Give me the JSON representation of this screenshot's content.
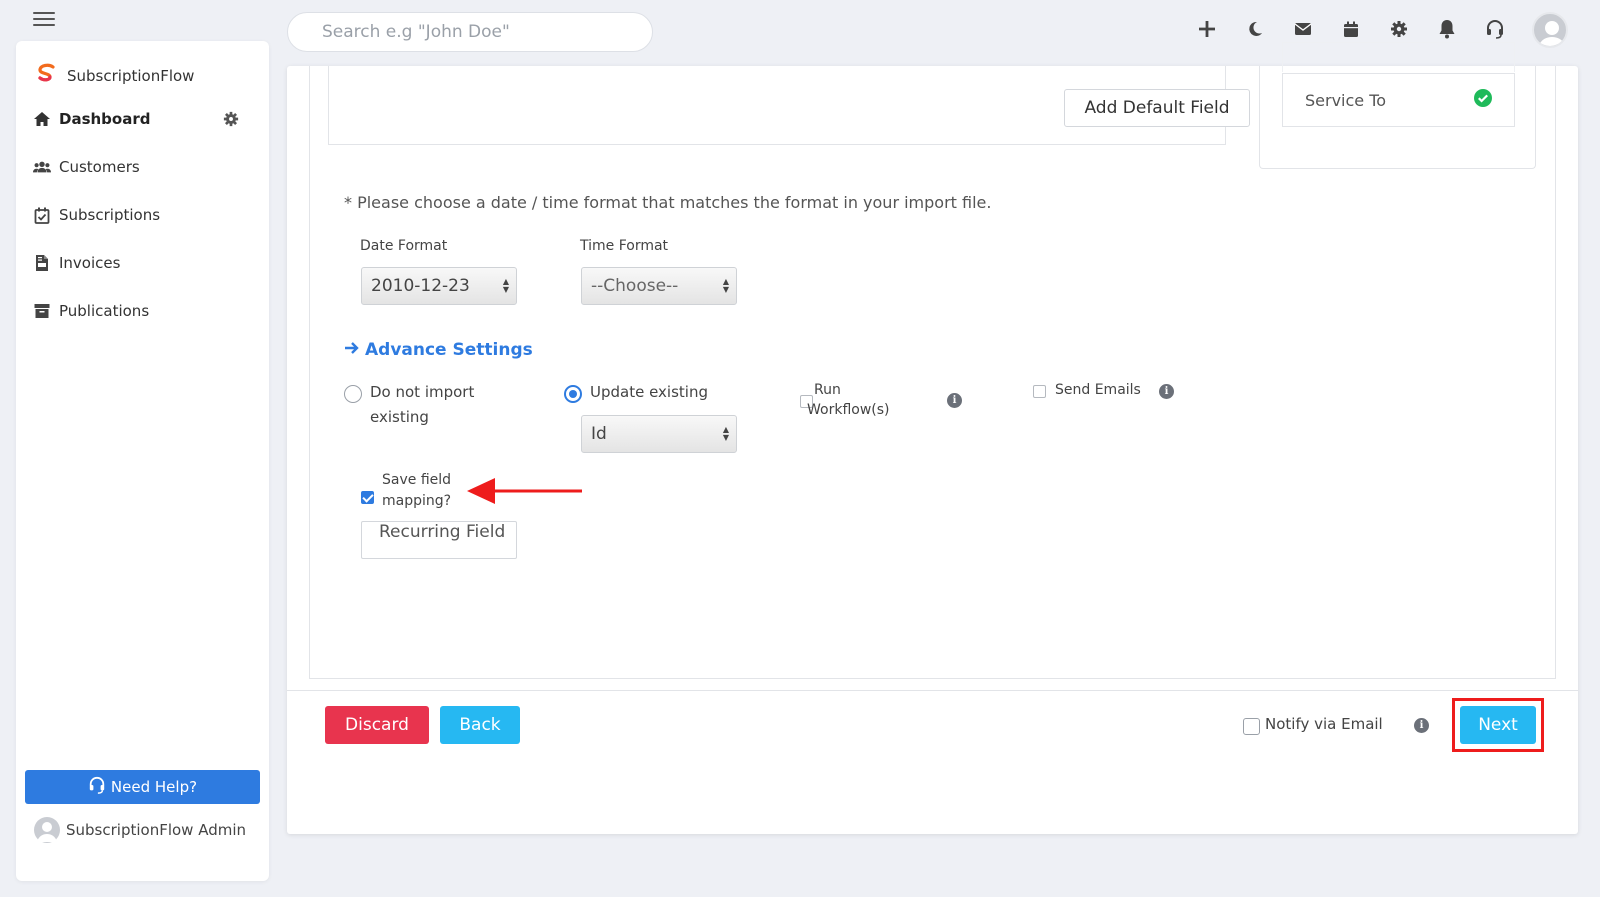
{
  "header": {
    "search_placeholder": "Search e.g \"John Doe\"",
    "icons": [
      "plus-icon",
      "moon-icon",
      "mail-icon",
      "calendar-icon",
      "gear-icon",
      "bell-icon",
      "headset-icon",
      "avatar"
    ]
  },
  "sidebar": {
    "brand": "SubscriptionFlow",
    "items": [
      {
        "label": "Dashboard",
        "icon": "home-icon"
      },
      {
        "label": "Customers",
        "icon": "users-icon"
      },
      {
        "label": "Subscriptions",
        "icon": "calendar-check-icon"
      },
      {
        "label": "Invoices",
        "icon": "file-invoice-icon"
      },
      {
        "label": "Publications",
        "icon": "archive-icon"
      }
    ],
    "help_label": "Need Help?",
    "user_name": "SubscriptionFlow Admin"
  },
  "main": {
    "add_default_field_label": "Add Default Field",
    "service_to_label": "Service To",
    "note": "* Please choose a date / time format that matches the format in your import file.",
    "date_format_label": "Date Format",
    "date_format_value": "2010-12-23",
    "time_format_label": "Time Format",
    "time_format_value": "--Choose--",
    "advance_settings_label": "Advance Settings",
    "options": {
      "do_not_import_line1": "Do not import",
      "do_not_import_line2": "existing",
      "update_existing": "Update existing",
      "update_key_value": "Id",
      "run_workflow_line1": "Run",
      "run_workflow_line2": "Workflow(s)",
      "send_emails": "Send Emails",
      "save_mapping_line1": "Save field",
      "save_mapping_line2": "mapping?",
      "recurring_field_value": "Recurring Field"
    }
  },
  "footer": {
    "discard_label": "Discard",
    "back_label": "Back",
    "notify_label": "Notify via Email",
    "next_label": "Next"
  },
  "colors": {
    "primary_blue": "#2e7be0",
    "cyan_button": "#26b8f2",
    "discard_red": "#e8344e",
    "highlight_red": "#ee1c1c",
    "success_green": "#1fba5a"
  }
}
